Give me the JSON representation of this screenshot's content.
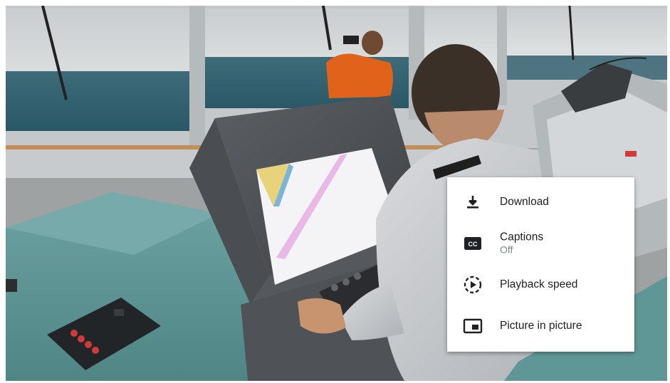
{
  "video": {
    "scene": "ship-bridge-training-video"
  },
  "menu": {
    "items": [
      {
        "icon": "download-icon",
        "label": "Download"
      },
      {
        "icon": "captions-icon",
        "label": "Captions",
        "sublabel": "Off"
      },
      {
        "icon": "playback-speed-icon",
        "label": "Playback speed"
      },
      {
        "icon": "picture-in-picture-icon",
        "label": "Picture in picture"
      }
    ]
  },
  "colors": {
    "menu_bg": "#ffffff",
    "menu_text": "#202124",
    "menu_subtext": "#80868b",
    "icon": "#202124"
  }
}
